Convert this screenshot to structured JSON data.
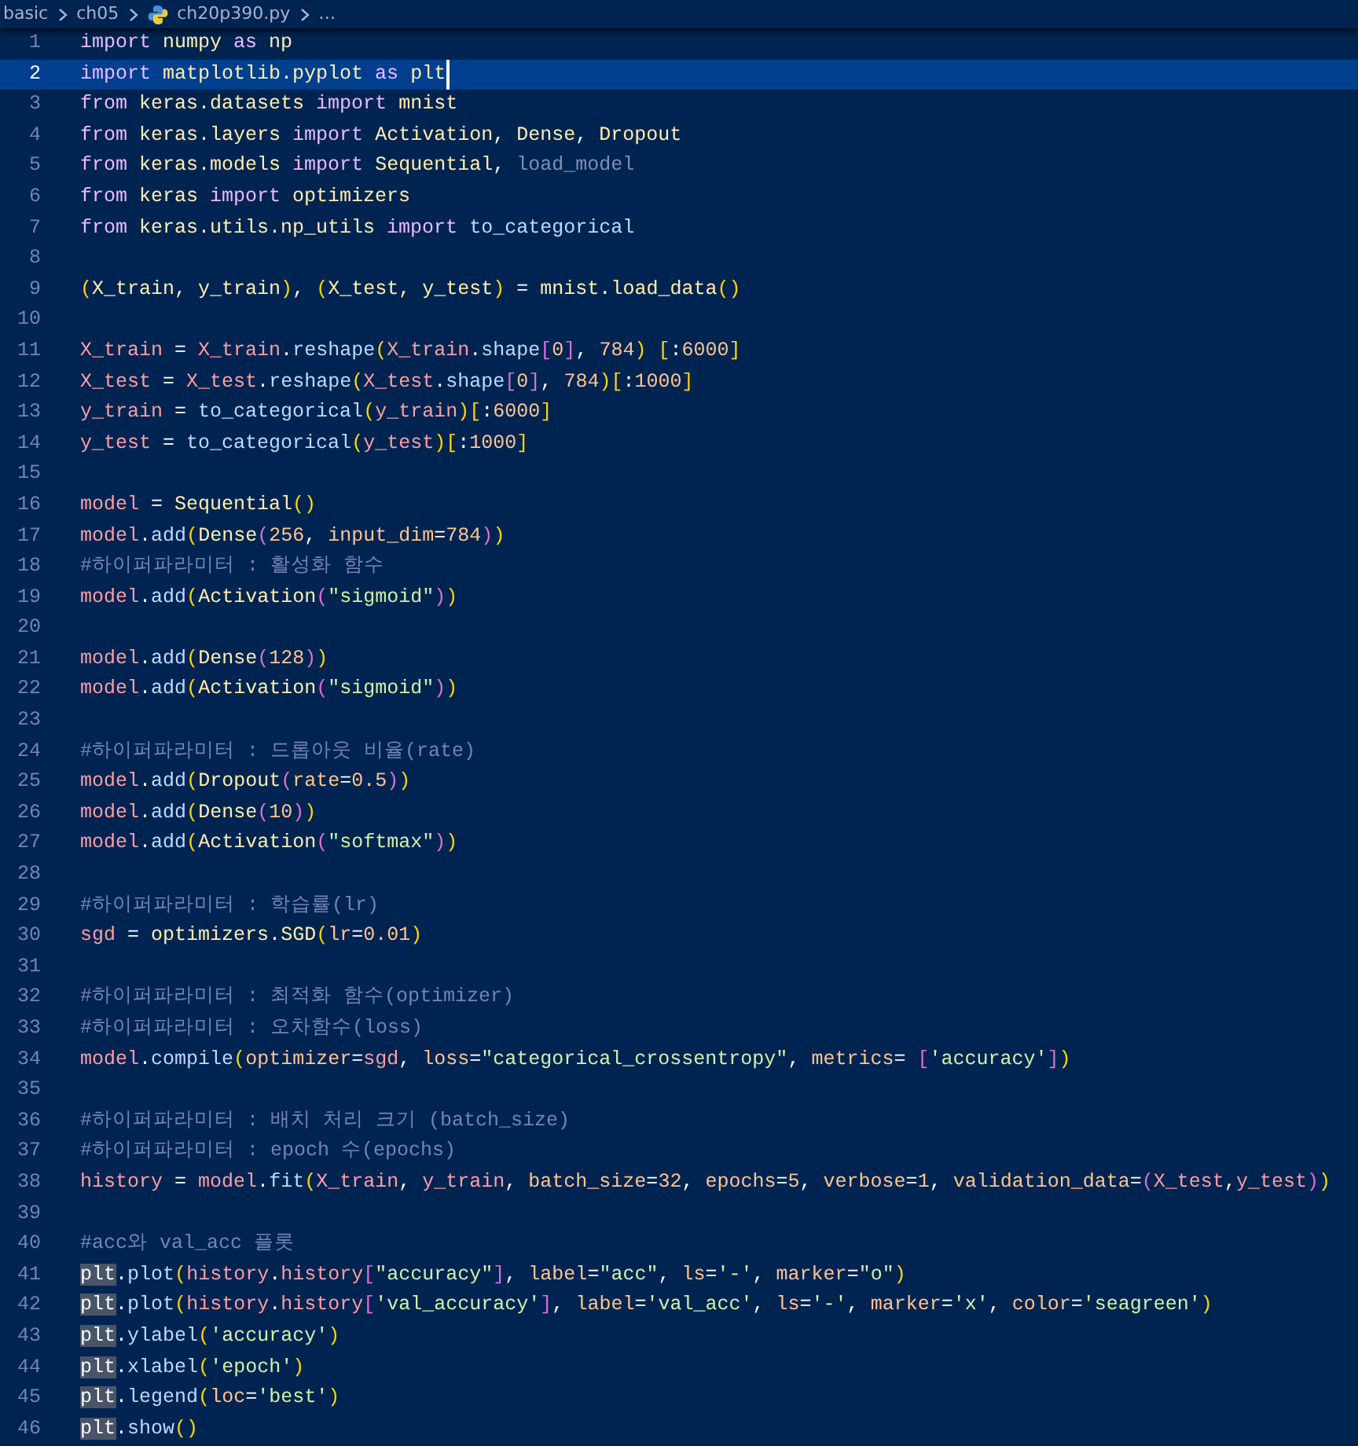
{
  "breadcrumb": [
    {
      "label": "basic",
      "kind": "folder"
    },
    {
      "label": "ch05",
      "kind": "folder"
    },
    {
      "label": "ch20p390.py",
      "kind": "file"
    },
    {
      "label": "…",
      "kind": "more"
    }
  ],
  "lines": [
    {
      "number": "1",
      "current": false,
      "tokens": [
        {
          "kind": "keyword",
          "text": "import "
        },
        {
          "kind": "module",
          "text": "numpy "
        },
        {
          "kind": "keyword",
          "text": "as "
        },
        {
          "kind": "module",
          "text": "np"
        }
      ]
    },
    {
      "number": "2",
      "current": true,
      "tokens": [
        {
          "kind": "keyword",
          "text": "import "
        },
        {
          "kind": "module",
          "text": "matplotlib.pyplot "
        },
        {
          "kind": "keyword",
          "text": "as "
        },
        {
          "kind": "module",
          "text": "plt"
        }
      ]
    },
    {
      "number": "3",
      "current": false,
      "tokens": [
        {
          "kind": "keyword",
          "text": "from "
        },
        {
          "kind": "module",
          "text": "keras.datasets "
        },
        {
          "kind": "keyword",
          "text": "import "
        },
        {
          "kind": "module",
          "text": "mnist"
        }
      ]
    },
    {
      "number": "4",
      "current": false,
      "tokens": [
        {
          "kind": "keyword",
          "text": "from "
        },
        {
          "kind": "module",
          "text": "keras.layers "
        },
        {
          "kind": "keyword",
          "text": "import "
        },
        {
          "kind": "module",
          "text": "Activation"
        },
        {
          "kind": "plain",
          "text": ", "
        },
        {
          "kind": "module",
          "text": "Dense"
        },
        {
          "kind": "plain",
          "text": ", "
        },
        {
          "kind": "module",
          "text": "Dropout"
        }
      ]
    },
    {
      "number": "5",
      "current": false,
      "tokens": [
        {
          "kind": "keyword",
          "text": "from "
        },
        {
          "kind": "module",
          "text": "keras.models "
        },
        {
          "kind": "keyword",
          "text": "import "
        },
        {
          "kind": "module",
          "text": "Sequential"
        },
        {
          "kind": "plain",
          "text": ", "
        },
        {
          "kind": "unused",
          "text": "load_model"
        }
      ]
    },
    {
      "number": "6",
      "current": false,
      "tokens": [
        {
          "kind": "keyword",
          "text": "from "
        },
        {
          "kind": "module",
          "text": "keras "
        },
        {
          "kind": "keyword",
          "text": "import "
        },
        {
          "kind": "module",
          "text": "optimizers"
        }
      ]
    },
    {
      "number": "7",
      "current": false,
      "tokens": [
        {
          "kind": "keyword",
          "text": "from "
        },
        {
          "kind": "module",
          "text": "keras.utils.np_utils "
        },
        {
          "kind": "keyword",
          "text": "import "
        },
        {
          "kind": "function",
          "text": "to_categorical"
        }
      ]
    },
    {
      "number": "8",
      "current": false
    },
    {
      "number": "9",
      "current": false,
      "tokens": [
        {
          "kind": "paren",
          "text": "("
        },
        {
          "kind": "module",
          "text": "X_train, y_train"
        },
        {
          "kind": "paren",
          "text": ")"
        },
        {
          "kind": "plain",
          "text": ", "
        },
        {
          "kind": "paren",
          "text": "("
        },
        {
          "kind": "module",
          "text": "X_test, y_test"
        },
        {
          "kind": "paren",
          "text": ")"
        },
        {
          "kind": "plain",
          "text": " = "
        },
        {
          "kind": "module",
          "text": "mnist"
        },
        {
          "kind": "plain",
          "text": "."
        },
        {
          "kind": "module",
          "text": "load_data"
        },
        {
          "kind": "paren",
          "text": "()"
        }
      ]
    },
    {
      "number": "10",
      "current": false
    },
    {
      "number": "11",
      "current": false,
      "tokens": [
        {
          "kind": "variable",
          "text": "X_train"
        },
        {
          "kind": "plain",
          "text": " = "
        },
        {
          "kind": "variable",
          "text": "X_train"
        },
        {
          "kind": "plain",
          "text": "."
        },
        {
          "kind": "function",
          "text": "reshape"
        },
        {
          "kind": "paren",
          "text": "("
        },
        {
          "kind": "variable",
          "text": "X_train"
        },
        {
          "kind": "plain",
          "text": "."
        },
        {
          "kind": "function",
          "text": "shape"
        },
        {
          "kind": "bracket",
          "text": "["
        },
        {
          "kind": "number",
          "text": "0"
        },
        {
          "kind": "bracket",
          "text": "]"
        },
        {
          "kind": "plain",
          "text": ", "
        },
        {
          "kind": "number",
          "text": "784"
        },
        {
          "kind": "paren",
          "text": ") ["
        },
        {
          "kind": "plain",
          "text": ":"
        },
        {
          "kind": "number",
          "text": "6000"
        },
        {
          "kind": "paren",
          "text": "]"
        }
      ]
    },
    {
      "number": "12",
      "current": false,
      "tokens": [
        {
          "kind": "variable",
          "text": "X_test"
        },
        {
          "kind": "plain",
          "text": " = "
        },
        {
          "kind": "variable",
          "text": "X_test"
        },
        {
          "kind": "plain",
          "text": "."
        },
        {
          "kind": "function",
          "text": "reshape"
        },
        {
          "kind": "paren",
          "text": "("
        },
        {
          "kind": "variable",
          "text": "X_test"
        },
        {
          "kind": "plain",
          "text": "."
        },
        {
          "kind": "function",
          "text": "shape"
        },
        {
          "kind": "bracket",
          "text": "["
        },
        {
          "kind": "number",
          "text": "0"
        },
        {
          "kind": "bracket",
          "text": "]"
        },
        {
          "kind": "plain",
          "text": ", "
        },
        {
          "kind": "number",
          "text": "784"
        },
        {
          "kind": "paren",
          "text": ")["
        },
        {
          "kind": "plain",
          "text": ":"
        },
        {
          "kind": "number",
          "text": "1000"
        },
        {
          "kind": "paren",
          "text": "]"
        }
      ]
    },
    {
      "number": "13",
      "current": false,
      "tokens": [
        {
          "kind": "variable",
          "text": "y_train"
        },
        {
          "kind": "plain",
          "text": " = "
        },
        {
          "kind": "function",
          "text": "to_categorical"
        },
        {
          "kind": "paren",
          "text": "("
        },
        {
          "kind": "variable",
          "text": "y_train"
        },
        {
          "kind": "paren",
          "text": ")["
        },
        {
          "kind": "plain",
          "text": ":"
        },
        {
          "kind": "number",
          "text": "6000"
        },
        {
          "kind": "paren",
          "text": "]"
        }
      ]
    },
    {
      "number": "14",
      "current": false,
      "tokens": [
        {
          "kind": "variable",
          "text": "y_test"
        },
        {
          "kind": "plain",
          "text": " = "
        },
        {
          "kind": "function",
          "text": "to_categorical"
        },
        {
          "kind": "paren",
          "text": "("
        },
        {
          "kind": "variable",
          "text": "y_test"
        },
        {
          "kind": "paren",
          "text": ")["
        },
        {
          "kind": "plain",
          "text": ":"
        },
        {
          "kind": "number",
          "text": "1000"
        },
        {
          "kind": "paren",
          "text": "]"
        }
      ]
    },
    {
      "number": "15",
      "current": false
    },
    {
      "number": "16",
      "current": false,
      "tokens": [
        {
          "kind": "variable",
          "text": "model"
        },
        {
          "kind": "plain",
          "text": " = "
        },
        {
          "kind": "module",
          "text": "Sequential"
        },
        {
          "kind": "paren",
          "text": "()"
        }
      ]
    },
    {
      "number": "17",
      "current": false,
      "tokens": [
        {
          "kind": "variable",
          "text": "model"
        },
        {
          "kind": "plain",
          "text": "."
        },
        {
          "kind": "function",
          "text": "add"
        },
        {
          "kind": "paren",
          "text": "("
        },
        {
          "kind": "module",
          "text": "Dense"
        },
        {
          "kind": "bracket",
          "text": "("
        },
        {
          "kind": "number",
          "text": "256"
        },
        {
          "kind": "plain",
          "text": ", "
        },
        {
          "kind": "number",
          "text": "input_dim"
        },
        {
          "kind": "plain",
          "text": "="
        },
        {
          "kind": "number",
          "text": "784"
        },
        {
          "kind": "bracket",
          "text": ")"
        },
        {
          "kind": "paren",
          "text": ")"
        }
      ]
    },
    {
      "number": "18",
      "current": false,
      "tokens": [
        {
          "kind": "comment",
          "text": "#하이퍼파라미터 : 활성화 함수"
        }
      ]
    },
    {
      "number": "19",
      "current": false,
      "tokens": [
        {
          "kind": "variable",
          "text": "model"
        },
        {
          "kind": "plain",
          "text": "."
        },
        {
          "kind": "function",
          "text": "add"
        },
        {
          "kind": "paren",
          "text": "("
        },
        {
          "kind": "module",
          "text": "Activation"
        },
        {
          "kind": "bracket",
          "text": "("
        },
        {
          "kind": "string",
          "text": "\"sigmoid\""
        },
        {
          "kind": "bracket",
          "text": ")"
        },
        {
          "kind": "paren",
          "text": ")"
        }
      ]
    },
    {
      "number": "20",
      "current": false
    },
    {
      "number": "21",
      "current": false,
      "tokens": [
        {
          "kind": "variable",
          "text": "model"
        },
        {
          "kind": "plain",
          "text": "."
        },
        {
          "kind": "function",
          "text": "add"
        },
        {
          "kind": "paren",
          "text": "("
        },
        {
          "kind": "module",
          "text": "Dense"
        },
        {
          "kind": "bracket",
          "text": "("
        },
        {
          "kind": "number",
          "text": "128"
        },
        {
          "kind": "bracket",
          "text": ")"
        },
        {
          "kind": "paren",
          "text": ")"
        }
      ]
    },
    {
      "number": "22",
      "current": false,
      "tokens": [
        {
          "kind": "variable",
          "text": "model"
        },
        {
          "kind": "plain",
          "text": "."
        },
        {
          "kind": "function",
          "text": "add"
        },
        {
          "kind": "paren",
          "text": "("
        },
        {
          "kind": "module",
          "text": "Activation"
        },
        {
          "kind": "bracket",
          "text": "("
        },
        {
          "kind": "string",
          "text": "\"sigmoid\""
        },
        {
          "kind": "bracket",
          "text": ")"
        },
        {
          "kind": "paren",
          "text": ")"
        }
      ]
    },
    {
      "number": "23",
      "current": false
    },
    {
      "number": "24",
      "current": false,
      "tokens": [
        {
          "kind": "comment",
          "text": "#하이퍼파라미터 : 드롭아웃 비율(rate)"
        }
      ]
    },
    {
      "number": "25",
      "current": false,
      "tokens": [
        {
          "kind": "variable",
          "text": "model"
        },
        {
          "kind": "plain",
          "text": "."
        },
        {
          "kind": "function",
          "text": "add"
        },
        {
          "kind": "paren",
          "text": "("
        },
        {
          "kind": "module",
          "text": "Dropout"
        },
        {
          "kind": "bracket",
          "text": "("
        },
        {
          "kind": "number",
          "text": "rate"
        },
        {
          "kind": "plain",
          "text": "="
        },
        {
          "kind": "number",
          "text": "0.5"
        },
        {
          "kind": "bracket",
          "text": ")"
        },
        {
          "kind": "paren",
          "text": ")"
        }
      ]
    },
    {
      "number": "26",
      "current": false,
      "tokens": [
        {
          "kind": "variable",
          "text": "model"
        },
        {
          "kind": "plain",
          "text": "."
        },
        {
          "kind": "function",
          "text": "add"
        },
        {
          "kind": "paren",
          "text": "("
        },
        {
          "kind": "module",
          "text": "Dense"
        },
        {
          "kind": "bracket",
          "text": "("
        },
        {
          "kind": "number",
          "text": "10"
        },
        {
          "kind": "bracket",
          "text": ")"
        },
        {
          "kind": "paren",
          "text": ")"
        }
      ]
    },
    {
      "number": "27",
      "current": false,
      "tokens": [
        {
          "kind": "variable",
          "text": "model"
        },
        {
          "kind": "plain",
          "text": "."
        },
        {
          "kind": "function",
          "text": "add"
        },
        {
          "kind": "paren",
          "text": "("
        },
        {
          "kind": "module",
          "text": "Activation"
        },
        {
          "kind": "bracket",
          "text": "("
        },
        {
          "kind": "string",
          "text": "\"softmax\""
        },
        {
          "kind": "bracket",
          "text": ")"
        },
        {
          "kind": "paren",
          "text": ")"
        }
      ]
    },
    {
      "number": "28",
      "current": false
    },
    {
      "number": "29",
      "current": false,
      "tokens": [
        {
          "kind": "comment",
          "text": "#하이퍼파라미터 : 학습률(lr)"
        }
      ]
    },
    {
      "number": "30",
      "current": false,
      "tokens": [
        {
          "kind": "variable",
          "text": "sgd"
        },
        {
          "kind": "plain",
          "text": " = "
        },
        {
          "kind": "module",
          "text": "optimizers"
        },
        {
          "kind": "plain",
          "text": "."
        },
        {
          "kind": "module",
          "text": "SGD"
        },
        {
          "kind": "paren",
          "text": "("
        },
        {
          "kind": "number",
          "text": "lr"
        },
        {
          "kind": "plain",
          "text": "="
        },
        {
          "kind": "number",
          "text": "0.01"
        },
        {
          "kind": "paren",
          "text": ")"
        }
      ]
    },
    {
      "number": "31",
      "current": false
    },
    {
      "number": "32",
      "current": false,
      "tokens": [
        {
          "kind": "comment",
          "text": "#하이퍼파라미터 : 최적화 함수(optimizer)"
        }
      ]
    },
    {
      "number": "33",
      "current": false,
      "tokens": [
        {
          "kind": "comment",
          "text": "#하이퍼파라미터 : 오차함수(loss)"
        }
      ]
    },
    {
      "number": "34",
      "current": false,
      "tokens": [
        {
          "kind": "variable",
          "text": "model"
        },
        {
          "kind": "plain",
          "text": "."
        },
        {
          "kind": "function",
          "text": "compile"
        },
        {
          "kind": "paren",
          "text": "("
        },
        {
          "kind": "number",
          "text": "optimizer"
        },
        {
          "kind": "plain",
          "text": "="
        },
        {
          "kind": "variable",
          "text": "sgd"
        },
        {
          "kind": "plain",
          "text": ", "
        },
        {
          "kind": "number",
          "text": "loss"
        },
        {
          "kind": "plain",
          "text": "="
        },
        {
          "kind": "string",
          "text": "\"categorical_crossentropy\""
        },
        {
          "kind": "plain",
          "text": ", "
        },
        {
          "kind": "number",
          "text": "metrics"
        },
        {
          "kind": "plain",
          "text": "= "
        },
        {
          "kind": "bracket",
          "text": "["
        },
        {
          "kind": "string",
          "text": "'accuracy'"
        },
        {
          "kind": "bracket",
          "text": "]"
        },
        {
          "kind": "paren",
          "text": ")"
        }
      ]
    },
    {
      "number": "35",
      "current": false
    },
    {
      "number": "36",
      "current": false,
      "tokens": [
        {
          "kind": "comment",
          "text": "#하이퍼파라미터 : 배치 처리 크기 (batch_size)"
        }
      ]
    },
    {
      "number": "37",
      "current": false,
      "tokens": [
        {
          "kind": "comment",
          "text": "#하이퍼파라미터 : epoch 수(epochs)"
        }
      ]
    },
    {
      "number": "38",
      "current": false,
      "tokens": [
        {
          "kind": "variable",
          "text": "history"
        },
        {
          "kind": "plain",
          "text": " = "
        },
        {
          "kind": "variable",
          "text": "model"
        },
        {
          "kind": "plain",
          "text": "."
        },
        {
          "kind": "function",
          "text": "fit"
        },
        {
          "kind": "paren",
          "text": "("
        },
        {
          "kind": "variable",
          "text": "X_train"
        },
        {
          "kind": "plain",
          "text": ", "
        },
        {
          "kind": "variable",
          "text": "y_train"
        },
        {
          "kind": "plain",
          "text": ", "
        },
        {
          "kind": "number",
          "text": "batch_size"
        },
        {
          "kind": "plain",
          "text": "="
        },
        {
          "kind": "number",
          "text": "32"
        },
        {
          "kind": "plain",
          "text": ", "
        },
        {
          "kind": "number",
          "text": "epochs"
        },
        {
          "kind": "plain",
          "text": "="
        },
        {
          "kind": "number",
          "text": "5"
        },
        {
          "kind": "plain",
          "text": ", "
        },
        {
          "kind": "number",
          "text": "verbose"
        },
        {
          "kind": "plain",
          "text": "="
        },
        {
          "kind": "number",
          "text": "1"
        },
        {
          "kind": "plain",
          "text": ", "
        },
        {
          "kind": "number",
          "text": "validation_data"
        },
        {
          "kind": "plain",
          "text": "="
        },
        {
          "kind": "bracket",
          "text": "("
        },
        {
          "kind": "variable",
          "text": "X_test"
        },
        {
          "kind": "plain",
          "text": ","
        },
        {
          "kind": "variable",
          "text": "y_test"
        },
        {
          "kind": "bracket",
          "text": ")"
        },
        {
          "kind": "paren",
          "text": ")"
        }
      ]
    },
    {
      "number": "39",
      "current": false
    },
    {
      "number": "40",
      "current": false,
      "tokens": [
        {
          "kind": "comment",
          "text": "#acc와 val_acc 플롯"
        }
      ]
    },
    {
      "number": "41",
      "current": false,
      "tokens": [
        {
          "kind": "match",
          "text": "plt"
        },
        {
          "kind": "plain",
          "text": "."
        },
        {
          "kind": "function",
          "text": "plot"
        },
        {
          "kind": "paren",
          "text": "("
        },
        {
          "kind": "variable",
          "text": "history"
        },
        {
          "kind": "plain",
          "text": "."
        },
        {
          "kind": "variable",
          "text": "history"
        },
        {
          "kind": "bracket",
          "text": "["
        },
        {
          "kind": "string",
          "text": "\"accuracy\""
        },
        {
          "kind": "bracket",
          "text": "]"
        },
        {
          "kind": "plain",
          "text": ", "
        },
        {
          "kind": "number",
          "text": "label"
        },
        {
          "kind": "plain",
          "text": "="
        },
        {
          "kind": "string",
          "text": "\"acc\""
        },
        {
          "kind": "plain",
          "text": ", "
        },
        {
          "kind": "number",
          "text": "ls"
        },
        {
          "kind": "plain",
          "text": "="
        },
        {
          "kind": "string",
          "text": "'-'"
        },
        {
          "kind": "plain",
          "text": ", "
        },
        {
          "kind": "number",
          "text": "marker"
        },
        {
          "kind": "plain",
          "text": "="
        },
        {
          "kind": "string",
          "text": "\"o\""
        },
        {
          "kind": "paren",
          "text": ")"
        }
      ]
    },
    {
      "number": "42",
      "current": false,
      "tokens": [
        {
          "kind": "match",
          "text": "plt"
        },
        {
          "kind": "plain",
          "text": "."
        },
        {
          "kind": "function",
          "text": "plot"
        },
        {
          "kind": "paren",
          "text": "("
        },
        {
          "kind": "variable",
          "text": "history"
        },
        {
          "kind": "plain",
          "text": "."
        },
        {
          "kind": "variable",
          "text": "history"
        },
        {
          "kind": "bracket",
          "text": "["
        },
        {
          "kind": "string",
          "text": "'val_accuracy'"
        },
        {
          "kind": "bracket",
          "text": "]"
        },
        {
          "kind": "plain",
          "text": ", "
        },
        {
          "kind": "number",
          "text": "label"
        },
        {
          "kind": "plain",
          "text": "="
        },
        {
          "kind": "string",
          "text": "'val_acc'"
        },
        {
          "kind": "plain",
          "text": ", "
        },
        {
          "kind": "number",
          "text": "ls"
        },
        {
          "kind": "plain",
          "text": "="
        },
        {
          "kind": "string",
          "text": "'-'"
        },
        {
          "kind": "plain",
          "text": ", "
        },
        {
          "kind": "number",
          "text": "marker"
        },
        {
          "kind": "plain",
          "text": "="
        },
        {
          "kind": "string",
          "text": "'x'"
        },
        {
          "kind": "plain",
          "text": ", "
        },
        {
          "kind": "number",
          "text": "color"
        },
        {
          "kind": "plain",
          "text": "="
        },
        {
          "kind": "string",
          "text": "'seagreen'"
        },
        {
          "kind": "paren",
          "text": ")"
        }
      ]
    },
    {
      "number": "43",
      "current": false,
      "tokens": [
        {
          "kind": "match",
          "text": "plt"
        },
        {
          "kind": "plain",
          "text": "."
        },
        {
          "kind": "function",
          "text": "ylabel"
        },
        {
          "kind": "paren",
          "text": "("
        },
        {
          "kind": "string",
          "text": "'accuracy'"
        },
        {
          "kind": "paren",
          "text": ")"
        }
      ]
    },
    {
      "number": "44",
      "current": false,
      "tokens": [
        {
          "kind": "match",
          "text": "plt"
        },
        {
          "kind": "plain",
          "text": "."
        },
        {
          "kind": "function",
          "text": "xlabel"
        },
        {
          "kind": "paren",
          "text": "("
        },
        {
          "kind": "string",
          "text": "'epoch'"
        },
        {
          "kind": "paren",
          "text": ")"
        }
      ]
    },
    {
      "number": "45",
      "current": false,
      "tokens": [
        {
          "kind": "match",
          "text": "plt"
        },
        {
          "kind": "plain",
          "text": "."
        },
        {
          "kind": "function",
          "text": "legend"
        },
        {
          "kind": "paren",
          "text": "("
        },
        {
          "kind": "number",
          "text": "loc"
        },
        {
          "kind": "plain",
          "text": "="
        },
        {
          "kind": "string",
          "text": "'best'"
        },
        {
          "kind": "paren",
          "text": ")"
        }
      ]
    },
    {
      "number": "46",
      "current": false,
      "tokens": [
        {
          "kind": "match",
          "text": "plt"
        },
        {
          "kind": "plain",
          "text": "."
        },
        {
          "kind": "function",
          "text": "show"
        },
        {
          "kind": "paren",
          "text": "()"
        }
      ]
    }
  ]
}
